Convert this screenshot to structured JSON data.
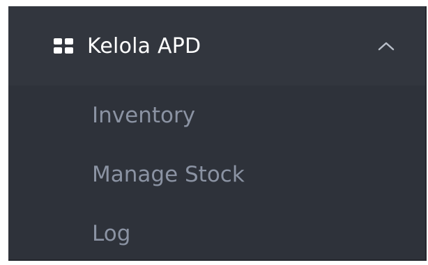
{
  "menu": {
    "header": {
      "title": "Kelola APD",
      "icon": "grid-icon",
      "toggle_icon": "chevron-up-icon"
    },
    "items": [
      {
        "label": "Inventory"
      },
      {
        "label": "Manage Stock"
      },
      {
        "label": "Log"
      }
    ]
  },
  "colors": {
    "background": "#2e323a",
    "header_background": "#32363e",
    "header_text": "#ffffff",
    "item_text": "#8b93a3"
  }
}
